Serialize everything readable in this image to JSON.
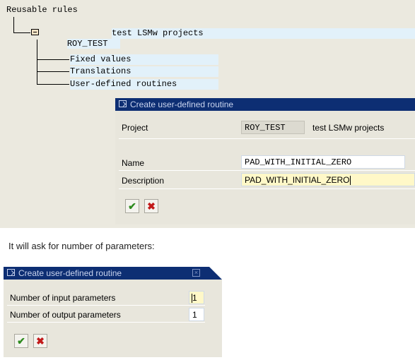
{
  "tree": {
    "root_label": "Reusable rules",
    "project_code": "ROY_TEST",
    "project_desc": "test LSMw projects",
    "children": [
      "Fixed values",
      "Translations",
      "User-defined routines"
    ]
  },
  "dialog1": {
    "title": "Create user-defined routine",
    "project_label": "Project",
    "project_value": "ROY_TEST",
    "project_desc": "test LSMw projects",
    "name_label": "Name",
    "name_value": "PAD_WITH_INITIAL_ZERO",
    "desc_label": "Description",
    "desc_value": "PAD_WITH_INITIAL_ZERO",
    "ok_glyph": "✔",
    "cancel_glyph": "✖"
  },
  "caption": "It will ask for number of parameters:",
  "dialog2": {
    "title": "Create user-defined routine",
    "input_label": "Number of input parameters",
    "input_value": "1",
    "output_label": "Number of output parameters",
    "output_value": "1",
    "ok_glyph": "✔",
    "cancel_glyph": "✖"
  },
  "colors": {
    "title_bar": "#0d2e73",
    "panel_bg": "#ebe9df",
    "dialog_bg": "#e8e6dc",
    "highlight": "#e2f1fa",
    "focus_field": "#fff8c8",
    "ok_green": "#2e8b1e",
    "cancel_red": "#c21a1a"
  },
  "icons": [
    "folder-icon",
    "window-icon",
    "checkmark-icon",
    "cancel-icon",
    "close-icon"
  ]
}
